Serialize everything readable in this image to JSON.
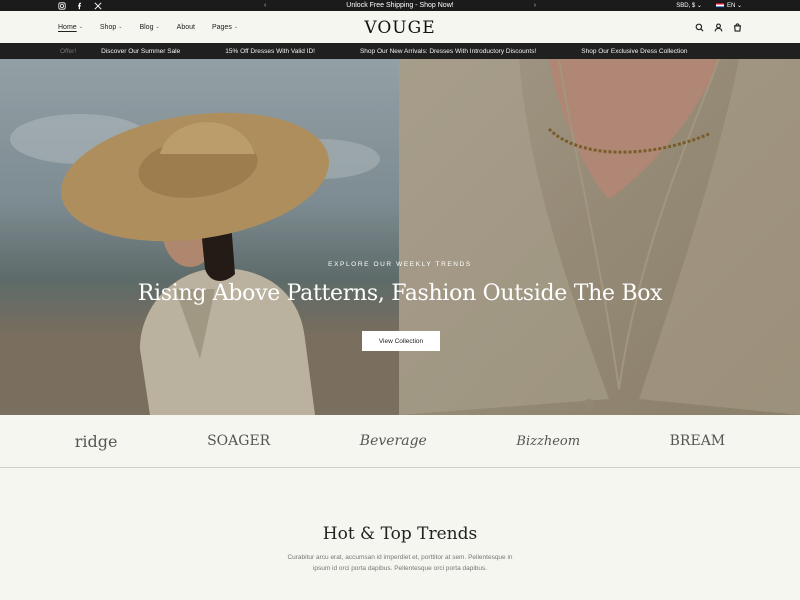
{
  "topbar": {
    "promo": "Unlock Free Shipping - Shop Now!",
    "currency": "SBD, $",
    "language": "EN"
  },
  "header": {
    "logo": "VOUGE",
    "nav": [
      {
        "label": "Home",
        "dropdown": true,
        "active": true
      },
      {
        "label": "Shop",
        "dropdown": true
      },
      {
        "label": "Blog",
        "dropdown": true
      },
      {
        "label": "About",
        "dropdown": false
      },
      {
        "label": "Pages",
        "dropdown": true
      }
    ]
  },
  "marquee": {
    "items": [
      "Offer!",
      "Discover Our Summer Sale",
      "15% Off Dresses With Valid ID!",
      "Shop Our New Arrivals: Dresses With Introductory Discounts!",
      "Shop Our Exclusive Dress Collection"
    ]
  },
  "hero": {
    "eyebrow": "EXPLORE OUR WEEKLY TRENDS",
    "title": "Rising Above Patterns, Fashion Outside The Box",
    "button": "View Collection"
  },
  "brands": [
    "ridge",
    "SOAGER",
    "Beverage",
    "Bizzheom",
    "BREAM"
  ],
  "trends": {
    "title": "Hot & Top Trends",
    "desc_line1": "Curabitur arcu erat, accumsan id imperdiet et, porttitor at sem. Pellentesque in",
    "desc_line2": "ipsum id orci porta dapibus. Pellentesque orci porta dapibus."
  },
  "colors": {
    "topbar": "#1b1b1b",
    "background": "#f5f6ef",
    "text": "#222222"
  }
}
